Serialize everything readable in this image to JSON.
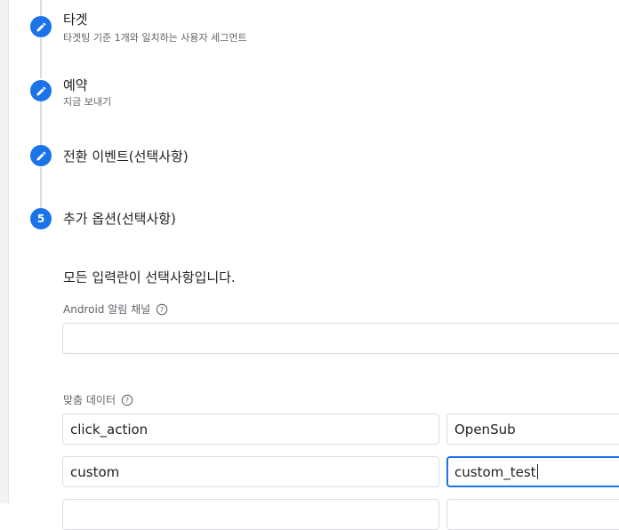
{
  "steps": [
    {
      "state": "done",
      "title": "타겟",
      "subtitle": "타겟팅 기준 1개와 일치하는 사용자 세그먼트"
    },
    {
      "state": "done",
      "title": "예약",
      "subtitle": "지금 보내기"
    },
    {
      "state": "done",
      "title": "전환 이벤트(선택사항)",
      "subtitle": ""
    },
    {
      "state": "active",
      "number": "5",
      "title": "추가 옵션(선택사항)",
      "subtitle": ""
    }
  ],
  "options": {
    "notice": "모든 입력란이 선택사항입니다.",
    "android_channel": {
      "label": "Android 알림 채널",
      "value": ""
    },
    "custom_data": {
      "label": "맞춤 데이터",
      "rows": [
        {
          "key": "click_action",
          "value": "OpenSub"
        },
        {
          "key": "custom",
          "value": "custom_test"
        }
      ]
    }
  },
  "colors": {
    "accent": "#1a73e8",
    "rail": "#dadce0",
    "border": "#dadce0",
    "muted": "#5f6368"
  }
}
